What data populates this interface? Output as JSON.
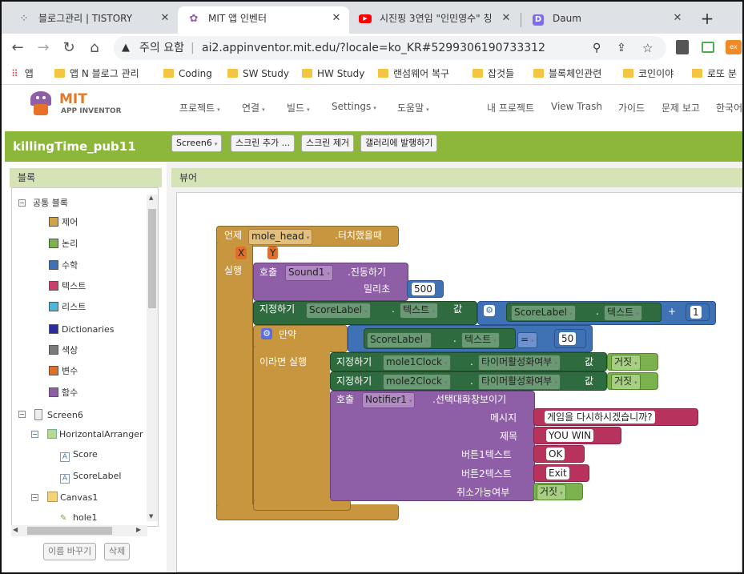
{
  "browser": {
    "tabs": [
      {
        "title": "블로그관리 | TISTORY",
        "icon": "tistory-icon"
      },
      {
        "title": "MIT 앱 인벤터",
        "icon": "appinventor-icon"
      },
      {
        "title": "시진핑 3연임 \"인민영수\" 칭",
        "icon": "youtube-icon"
      },
      {
        "title": "Daum",
        "icon": "daum-icon"
      }
    ],
    "new_tab": "+",
    "url_warning": "주의 요함",
    "url": "ai2.appinventor.mit.edu/?locale=ko_KR#5299306190733312",
    "bookmarks": [
      "앱",
      "앱 N 블로그 관리",
      "Coding",
      "SW Study",
      "HW Study",
      "랜섬웨어 복구",
      "잡것들",
      "블록체인관련",
      "코인이야",
      "로또 분"
    ]
  },
  "app": {
    "logo_mit": "MIT",
    "logo_sub": "APP INVENTOR",
    "menu": [
      "프로젝트",
      "연결",
      "빌드",
      "Settings",
      "도움말"
    ],
    "right_menu": [
      "내 프로젝트",
      "View Trash",
      "가이드",
      "문제 보고",
      "한국어"
    ],
    "project_name": "killingTime_pub11",
    "screen_btn": "Screen6",
    "add_screen": "스크린 추가 ...",
    "remove_screen": "스크린 제거",
    "publish": "갤러리에 발행하기",
    "blocks_title": "블록",
    "viewer_title": "뷰어",
    "rename": "이름 바꾸기",
    "delete": "삭제"
  },
  "tree": {
    "builtin": "공통 블록",
    "categories": [
      {
        "label": "제어",
        "color": "#d4a246"
      },
      {
        "label": "논리",
        "color": "#7bb24d"
      },
      {
        "label": "수학",
        "color": "#3f71b5"
      },
      {
        "label": "텍스트",
        "color": "#c8416b"
      },
      {
        "label": "리스트",
        "color": "#4fb6d9"
      },
      {
        "label": "Dictionaries",
        "color": "#2b2c9c"
      },
      {
        "label": "색상",
        "color": "#7a7a7a"
      },
      {
        "label": "변수",
        "color": "#e06f2b"
      },
      {
        "label": "함수",
        "color": "#8e5fa6"
      }
    ],
    "screen": "Screen6",
    "arrangement": "HorizontalArranger",
    "score": "Score",
    "score_label": "ScoreLabel",
    "canvas": "Canvas1",
    "hole": "hole1"
  },
  "blocks": {
    "event_when": "언제",
    "event_component": "mole_head",
    "event_name": ".터치했을때",
    "param_x": "X",
    "param_y": "Y",
    "do": "실행",
    "call": "호출",
    "sound": "Sound1",
    "vibrate": ".진동하기",
    "millis": "밀리초",
    "millis_val": "500",
    "set": "지정하기",
    "scorelabel": "ScoreLabel",
    "dot": ".",
    "text_prop": "텍스트",
    "value": "값",
    "plus": "+",
    "one": "1",
    "if": "만약",
    "eq": "=",
    "fifty": "50",
    "then": "이라면 실행",
    "mole1clock": "mole1Clock",
    "mole2clock": "mole2Clock",
    "timer_enabled": "타이머활성화여부",
    "false": "거짓",
    "notifier": "Notifier1",
    "choose": ".선택대화창보이기",
    "message": "메시지",
    "message_val": "게임을  다시하시겠습니까?",
    "title": "제목",
    "title_val": "YOU  WIN",
    "btn1": "버튼1텍스트",
    "btn1_val": "OK",
    "btn2": "버튼2텍스트",
    "btn2_val": "Exit",
    "cancelable": "취소가능여부",
    "cancel_val": "거짓"
  }
}
